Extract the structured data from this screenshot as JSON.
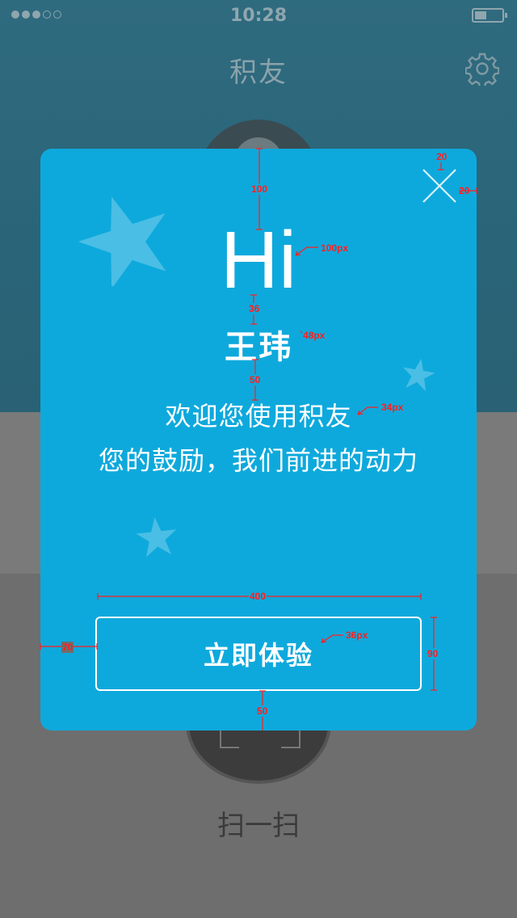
{
  "status_bar": {
    "time": "10:28",
    "signal_bars": 3,
    "signal_total": 5
  },
  "app": {
    "title": "积友",
    "settings_icon": "gear-icon",
    "scan_label": "扫一扫"
  },
  "modal": {
    "greeting": "Hi",
    "username": "王玮",
    "welcome": "欢迎您使用积友",
    "slogan": "您的鼓励，我们前进的动力",
    "cta_label": "立即体验",
    "close_icon": "close-icon",
    "decoration": "star-icon"
  },
  "annotations": {
    "close_top": "20",
    "close_right": "20",
    "hi_top": "100",
    "hi_size": "100px",
    "hi_name_gap": "36",
    "name_size": "48px",
    "name_welcome_gap": "50",
    "welcome_size": "34px",
    "button_width": "400",
    "button_size": "36px",
    "button_left": "70",
    "button_height": "90",
    "button_bottom": "50"
  },
  "colors": {
    "modal_bg": "#0ea9dc",
    "annotation": "#ff1e1e",
    "header_bg": "#2f6b7f"
  }
}
